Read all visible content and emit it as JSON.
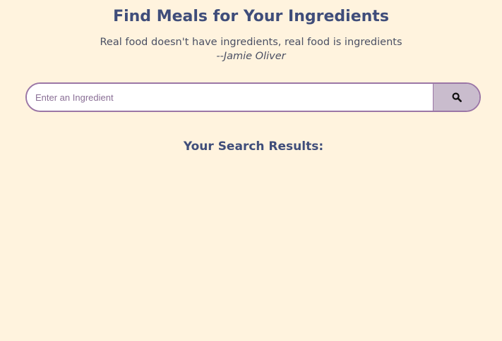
{
  "header": {
    "title": "Find Meals for Your Ingredients",
    "quote_text": "Real food doesn't have ingredients, real food is ingredients",
    "quote_author": "--Jamie Oliver"
  },
  "search": {
    "placeholder": "Enter an Ingredient",
    "value": "",
    "button_icon": "search-icon"
  },
  "results": {
    "heading": "Your Search Results:",
    "items": []
  },
  "colors": {
    "background": "#fff3de",
    "heading": "#3f4d7a",
    "border_accent": "#9b76a6",
    "button_bg": "#c9bccd"
  }
}
